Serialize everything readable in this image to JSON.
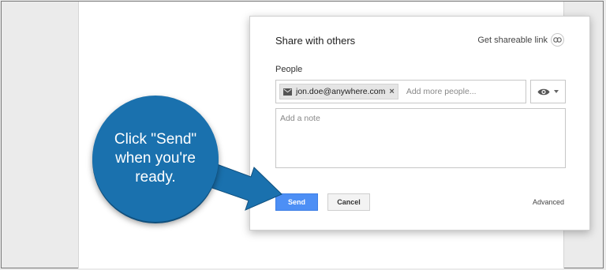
{
  "dialog": {
    "title": "Share with others",
    "shareable_link_label": "Get shareable link",
    "people_label": "People",
    "recipient_chip": "jon.doe@anywhere.com",
    "add_people_placeholder": "Add more people...",
    "note_placeholder": "Add a note",
    "send_label": "Send",
    "cancel_label": "Cancel",
    "advanced_label": "Advanced"
  },
  "callout": {
    "text": "Click \"Send\" when you're ready."
  },
  "colors": {
    "callout_blue": "#1a71ae",
    "send_blue": "#4d8ff5"
  }
}
